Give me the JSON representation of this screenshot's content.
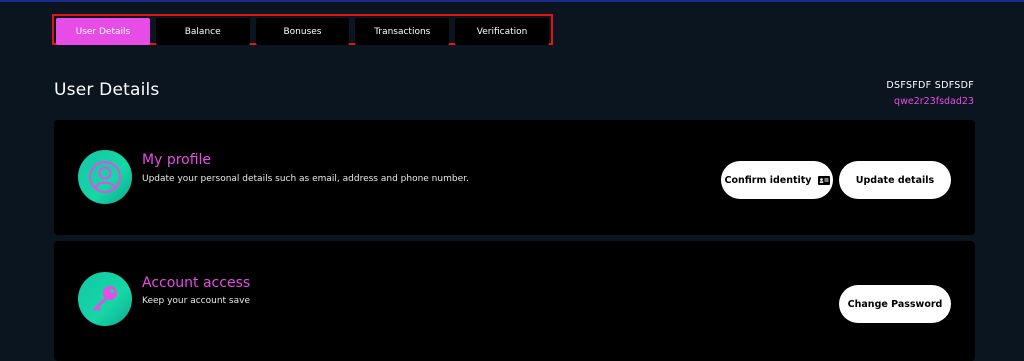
{
  "tabs": [
    {
      "label": "User Details",
      "active": true
    },
    {
      "label": "Balance",
      "active": false
    },
    {
      "label": "Bonuses",
      "active": false
    },
    {
      "label": "Transactions",
      "active": false
    },
    {
      "label": "Verification",
      "active": false
    }
  ],
  "page": {
    "title": "User Details",
    "user_name": "DSFSFDF SDFSDF",
    "user_id": "qwe2r23fsdad23"
  },
  "profile_card": {
    "icon": "user-profile-icon",
    "title": "My profile",
    "description": "Update your personal details such as email, address and phone number.",
    "confirm_label": "Confirm identity",
    "update_label": "Update details"
  },
  "access_card": {
    "icon": "key-icon",
    "title": "Account access",
    "description": "Keep your account save",
    "change_password_label": "Change Password"
  },
  "colors": {
    "accent": "#e84ce6",
    "background": "#0b1520",
    "card": "#000000",
    "icon_bg": "#16d6a6",
    "highlight_border": "#e01515"
  }
}
